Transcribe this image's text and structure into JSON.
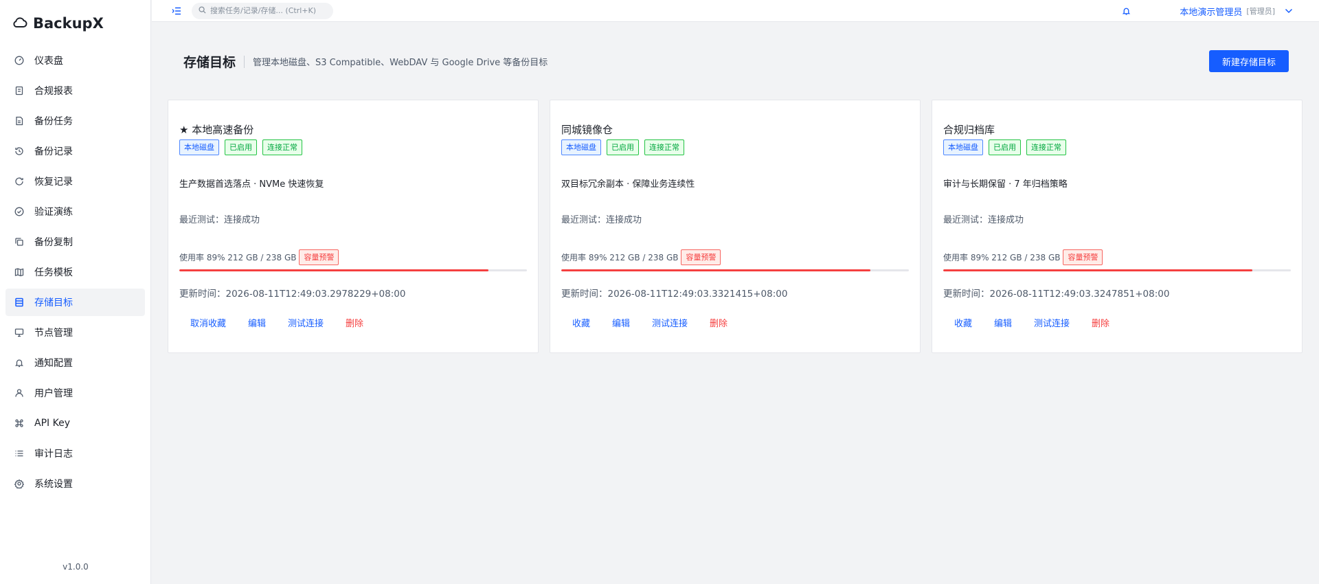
{
  "app": {
    "name": "BackupX",
    "version": "v1.0.0"
  },
  "sidebar": {
    "items": [
      {
        "label": "仪表盘",
        "icon": "dashboard-icon"
      },
      {
        "label": "合规报表",
        "icon": "report-icon"
      },
      {
        "label": "备份任务",
        "icon": "task-icon"
      },
      {
        "label": "备份记录",
        "icon": "history-icon"
      },
      {
        "label": "恢复记录",
        "icon": "restore-icon"
      },
      {
        "label": "验证演练",
        "icon": "shield-check-icon"
      },
      {
        "label": "备份复制",
        "icon": "copy-icon"
      },
      {
        "label": "任务模板",
        "icon": "template-icon"
      },
      {
        "label": "存储目标",
        "icon": "storage-icon",
        "active": true
      },
      {
        "label": "节点管理",
        "icon": "monitor-icon"
      },
      {
        "label": "通知配置",
        "icon": "bell-icon"
      },
      {
        "label": "用户管理",
        "icon": "user-icon"
      },
      {
        "label": "API Key",
        "icon": "command-icon"
      },
      {
        "label": "审计日志",
        "icon": "list-icon"
      },
      {
        "label": "系统设置",
        "icon": "gear-icon"
      }
    ]
  },
  "topbar": {
    "search_placeholder": "搜索任务/记录/存储... (Ctrl+K)",
    "user_name": "本地演示管理员",
    "user_role": "[管理员]"
  },
  "header": {
    "title": "存储目标",
    "subtitle": "管理本地磁盘、S3 Compatible、WebDAV 与 Google Drive 等备份目标",
    "new_button": "新建存储目标"
  },
  "colors": {
    "accent": "#165dff",
    "danger": "#f53f3f",
    "success": "#00a63e"
  },
  "cards": [
    {
      "name": "★ 本地高速备份",
      "tags": [
        "本地磁盘",
        "已启用",
        "连接正常"
      ],
      "description": "生产数据首选落点 · NVMe 快速恢复",
      "test_result": "最近测试：连接成功",
      "usage_text": "使用率 89% 212 GB / 238 GB",
      "usage_percent": 89,
      "warning_tag": "容量预警",
      "updated": "更新时间：2026-08-11T12:49:03.2978229+08:00",
      "actions": [
        "取消收藏",
        "编辑",
        "测试连接",
        "删除"
      ]
    },
    {
      "name": "同城镜像仓",
      "tags": [
        "本地磁盘",
        "已启用",
        "连接正常"
      ],
      "description": "双目标冗余副本 · 保障业务连续性",
      "test_result": "最近测试：连接成功",
      "usage_text": "使用率 89% 212 GB / 238 GB",
      "usage_percent": 89,
      "warning_tag": "容量预警",
      "updated": "更新时间：2026-08-11T12:49:03.3321415+08:00",
      "actions": [
        "收藏",
        "编辑",
        "测试连接",
        "删除"
      ]
    },
    {
      "name": "合规归档库",
      "tags": [
        "本地磁盘",
        "已启用",
        "连接正常"
      ],
      "description": "审计与长期保留 · 7 年归档策略",
      "test_result": "最近测试：连接成功",
      "usage_text": "使用率 89% 212 GB / 238 GB",
      "usage_percent": 89,
      "warning_tag": "容量预警",
      "updated": "更新时间：2026-08-11T12:49:03.3247851+08:00",
      "actions": [
        "收藏",
        "编辑",
        "测试连接",
        "删除"
      ]
    }
  ]
}
